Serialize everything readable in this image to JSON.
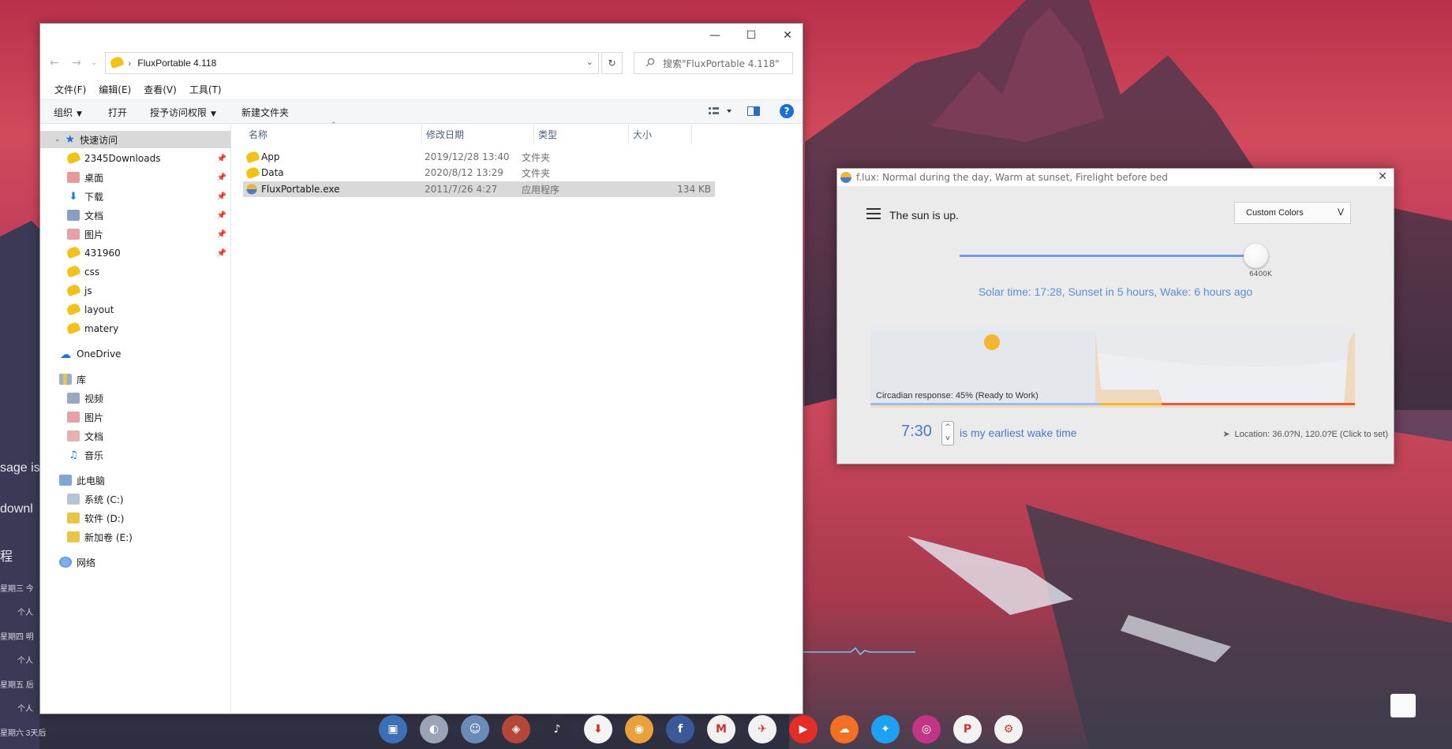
{
  "desktop": {
    "left_texts": [
      {
        "text": "sage is",
        "size": "big"
      },
      {
        "text": "downl",
        "size": "big"
      },
      {
        "text": "程",
        "size": "big"
      },
      {
        "text": "星期三 今",
        "size": "small"
      },
      {
        "text": "个人",
        "size": "small"
      },
      {
        "text": "星期四 明",
        "size": "small"
      },
      {
        "text": "个人",
        "size": "small"
      },
      {
        "text": "星期五 后",
        "size": "small"
      },
      {
        "text": "个人",
        "size": "small"
      },
      {
        "text": "星期六 3天后",
        "size": "small"
      }
    ]
  },
  "explorer": {
    "title": "FluxPortable 4.118",
    "window_controls": {
      "minimize": "—",
      "maximize": "☐",
      "close": "✕"
    },
    "address": {
      "path": "FluxPortable 4.118"
    },
    "search": {
      "placeholder": "搜索\"FluxPortable 4.118\""
    },
    "menubar": [
      "文件(F)",
      "编辑(E)",
      "查看(V)",
      "工具(T)"
    ],
    "toolbar": {
      "organize": "组织",
      "open": "打开",
      "grant_access": "授予访问权限",
      "new_folder": "新建文件夹",
      "help": "?"
    },
    "nav_pane": {
      "quick_access": "快速访问",
      "quick_items": [
        {
          "label": "2345Downloads",
          "pinned": true,
          "icon": "folder"
        },
        {
          "label": "桌面",
          "pinned": true,
          "icon": "desktop"
        },
        {
          "label": "下载",
          "pinned": true,
          "icon": "download"
        },
        {
          "label": "文档",
          "pinned": true,
          "icon": "documents"
        },
        {
          "label": "图片",
          "pinned": true,
          "icon": "pictures"
        },
        {
          "label": "431960",
          "pinned": true,
          "icon": "folder"
        },
        {
          "label": "css",
          "pinned": false,
          "icon": "folder"
        },
        {
          "label": "js",
          "pinned": false,
          "icon": "folder"
        },
        {
          "label": "layout",
          "pinned": false,
          "icon": "folder"
        },
        {
          "label": "matery",
          "pinned": false,
          "icon": "folder"
        }
      ],
      "onedrive": "OneDrive",
      "library": "库",
      "library_items": [
        "视频",
        "图片",
        "文档",
        "音乐"
      ],
      "this_pc": "此电脑",
      "drives": [
        "系统 (C:)",
        "软件 (D:)",
        "新加卷 (E:)"
      ],
      "network": "网络"
    },
    "columns": [
      "名称",
      "修改日期",
      "类型",
      "大小"
    ],
    "files": [
      {
        "name": "App",
        "date": "2019/12/28 13:40",
        "type": "文件夹",
        "size": "",
        "icon": "folder",
        "selected": false
      },
      {
        "name": "Data",
        "date": "2020/8/12 13:29",
        "type": "文件夹",
        "size": "",
        "icon": "folder",
        "selected": false
      },
      {
        "name": "FluxPortable.exe",
        "date": "2011/7/26 4:27",
        "type": "应用程序",
        "size": "134 KB",
        "icon": "flux-exe",
        "selected": true
      }
    ]
  },
  "flux": {
    "title": "f.lux: Normal during the day, Warm at sunset, Firelight before bed",
    "close": "✕",
    "status": "The sun is up.",
    "color_mode": "Custom Colors",
    "color_mode_caret": "V",
    "temperature_label": "6400K",
    "temperature_fraction": 0.95,
    "solar_line": "Solar time: 17:28, Sunset in 5 hours, Wake: 6 hours ago",
    "circadian": "Circadian response: 45% (Ready to Work)",
    "wake_time": "7:30",
    "wake_suffix": "is my earliest wake time",
    "location": "Location: 36.0?N, 120.0?E (Click to set)",
    "colors": {
      "accent": "#5a90d6",
      "warm": "#f4b530",
      "fire": "#f0583a"
    }
  },
  "dock": {
    "apps": [
      {
        "name": "computer-icon",
        "color": "#3b6fb6",
        "glyph": "▣"
      },
      {
        "name": "wallpaper-app-icon",
        "color": "#9aa4b4",
        "glyph": "◐"
      },
      {
        "name": "finder-icon",
        "color": "#6a8ab8",
        "glyph": "☺"
      },
      {
        "name": "game-icon",
        "color": "#b4463a",
        "glyph": "◈"
      },
      {
        "name": "music-app-icon",
        "color": "#2e2e3e",
        "glyph": "♪"
      },
      {
        "name": "download-icon",
        "color": "#f4f4f4",
        "glyph": "⬇"
      },
      {
        "name": "chrome-icon",
        "color": "#e9a23b",
        "glyph": "◉"
      },
      {
        "name": "facebook-icon",
        "color": "#3b5998",
        "glyph": "f"
      },
      {
        "name": "gmail-icon",
        "color": "#f1f1f1",
        "glyph": "M"
      },
      {
        "name": "defiant-icon",
        "color": "#f1f1f1",
        "glyph": "✈"
      },
      {
        "name": "youtube-icon",
        "color": "#e52d27",
        "glyph": "▶"
      },
      {
        "name": "soundcloud-icon",
        "color": "#f26f23",
        "glyph": "☁"
      },
      {
        "name": "twitter-icon",
        "color": "#1da1f2",
        "glyph": "✦"
      },
      {
        "name": "instagram-icon",
        "color": "#c13584",
        "glyph": "◎"
      },
      {
        "name": "pinterest-icon",
        "color": "#f2f2f2",
        "glyph": "P"
      },
      {
        "name": "settings-app-icon",
        "color": "#f2f2f2",
        "glyph": "⚙"
      }
    ]
  }
}
